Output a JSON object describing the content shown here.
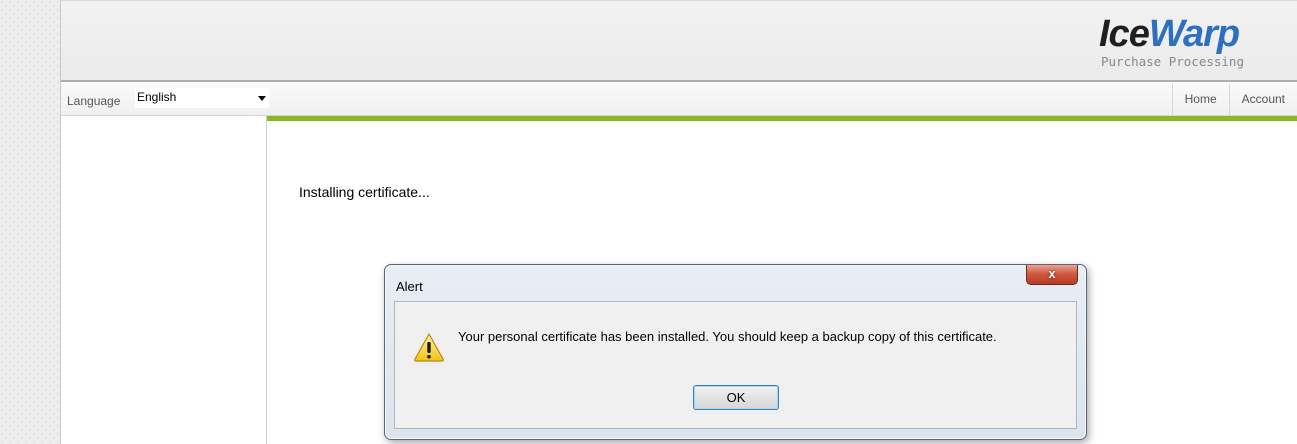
{
  "brand": {
    "name_part1": "Ice",
    "name_part2": "Warp",
    "subtitle": "Purchase Processing",
    "accent_color": "#2e6fc2"
  },
  "toolbar": {
    "language_label": "Language",
    "language_value": "English"
  },
  "nav": {
    "items": [
      {
        "label": "Home"
      },
      {
        "label": "Account"
      }
    ]
  },
  "main": {
    "status_text": "Installing certificate...",
    "divider_color": "#8cb624"
  },
  "dialog": {
    "title": "Alert",
    "message": "Your personal certificate has been installed. You should keep a backup copy of this certificate.",
    "ok_label": "OK",
    "close_label": "x",
    "icon": "warning-icon"
  }
}
